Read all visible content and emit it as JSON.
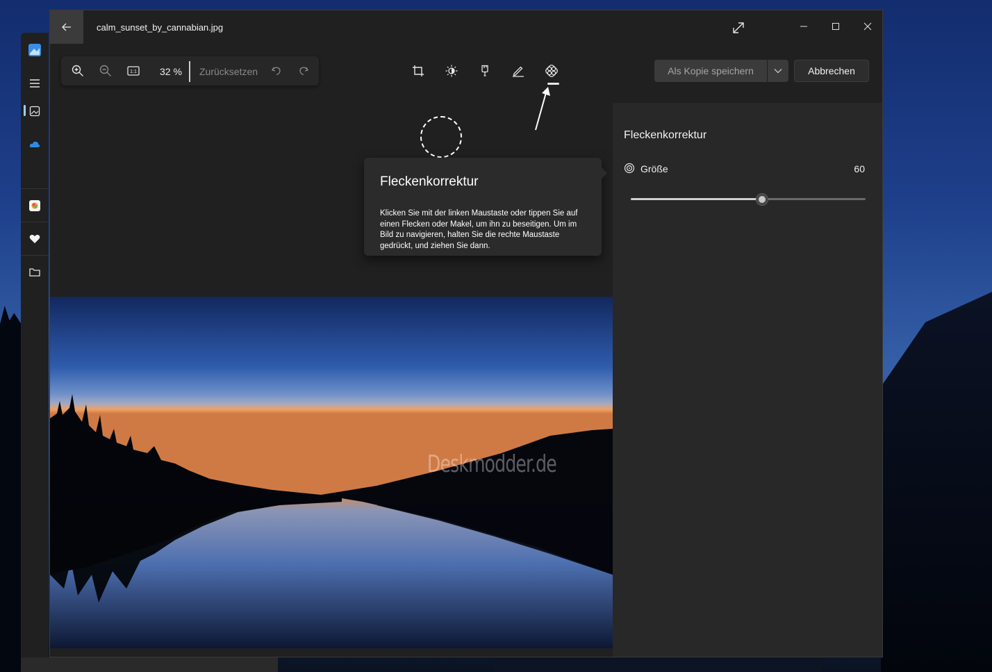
{
  "window": {
    "title": "calm_sunset_by_cannabian.jpg",
    "back_icon": "arrow-left-icon",
    "expand_icon": "expand-diagonal-icon",
    "controls": {
      "minimize": "—",
      "maximize": "☐",
      "close": "✕"
    }
  },
  "toolbar": {
    "zoom_in_icon": "zoom-in-icon",
    "zoom_out_icon": "zoom-out-icon",
    "actual_size_icon": "actual-size-icon",
    "actual_size_glyph": "1:1",
    "zoom_value": "32 %",
    "reset_label": "Zurücksetzen",
    "undo_icon": "undo-icon",
    "redo_icon": "redo-icon"
  },
  "edit_tools": [
    {
      "name": "crop-icon",
      "active": false
    },
    {
      "name": "adjust-brightness-icon",
      "active": false
    },
    {
      "name": "filter-icon",
      "active": false
    },
    {
      "name": "markup-pen-icon",
      "active": false
    },
    {
      "name": "spot-fix-icon",
      "active": true
    }
  ],
  "actions": {
    "save_copy_label": "Als Kopie speichern",
    "cancel_label": "Abbrechen",
    "dropdown_icon": "chevron-down-icon"
  },
  "tooltip": {
    "title": "Fleckenkorrektur",
    "text": "Klicken Sie mit der linken Maustaste oder tippen Sie auf einen Flecken oder Makel, um ihn zu beseitigen. Um im Bild zu navigieren, halten Sie die rechte Maustaste gedrückt, und ziehen Sie dann."
  },
  "panel": {
    "title": "Fleckenkorrektur",
    "size_label": "Größe",
    "size_value": "60",
    "size_fraction": 0.56
  },
  "photo": {
    "watermark": "Deskmodder.de"
  },
  "bg_sidebar": {
    "icons": [
      "photos-app-icon",
      "menu-icon",
      "gallery-icon",
      "onedrive-icon",
      "icloud-photos-icon",
      "favorites-heart-icon",
      "folder-icon"
    ]
  },
  "colors": {
    "window_bg": "#202020",
    "panel_bg": "#282828",
    "accent_active": "#e6e6e6"
  }
}
